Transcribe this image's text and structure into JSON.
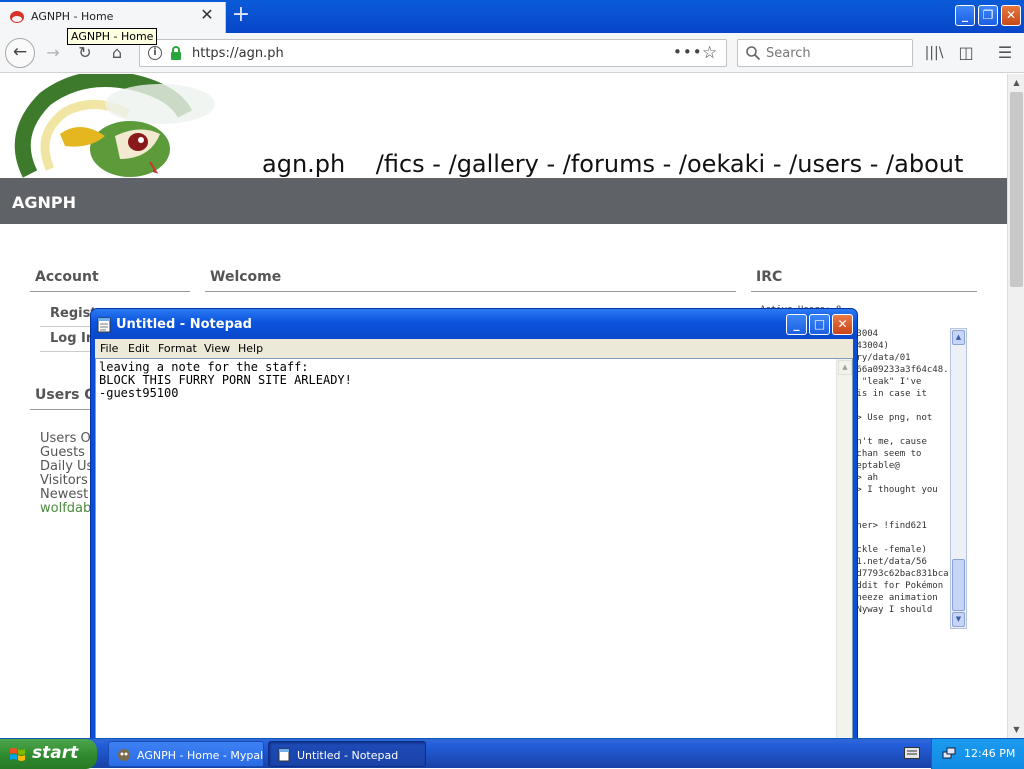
{
  "browser": {
    "tab_title": "AGNPH - Home",
    "tooltip": "AGNPH - Home",
    "url": "https://agn.ph",
    "search_placeholder": "Search"
  },
  "site": {
    "nav": [
      "agn.ph",
      "/fics",
      "-",
      "/gallery",
      "-",
      "/forums",
      "-",
      "/oekaki",
      "-",
      "/users",
      "-",
      "/about"
    ],
    "banner": "AGNPH",
    "account_heading": "Account",
    "welcome_heading": "Welcome",
    "irc_heading": "IRC",
    "account_links": [
      "Regist",
      "Log In"
    ],
    "users_heading": "Users O",
    "stats": [
      "Users O",
      "Guests",
      "Daily Us",
      "Visitors",
      "Newest",
      "wolfdab"
    ],
    "irc_lines": [
      "Active Users: 8",
      "43004",
      "343004)",
      "ery/data/01",
      "f66a09233a3f64c48.",
      "t \"leak\" I've",
      "his in case it",
      "",
      "e> Use png, not",
      "",
      "in't me, cause",
      "8chan seem to",
      "ceptable@",
      "e> ah",
      "e> I thought you",
      "",
      "",
      "iner> !find621",
      "",
      "uckle -female)",
      "21.net/data/56",
      "2d7793c62bac831bca.",
      "eddit for Pokémon",
      " sneeze animation",
      " ANyway I should"
    ]
  },
  "notepad": {
    "title": "Untitled - Notepad",
    "menu": [
      "File",
      "Edit",
      "Format",
      "View",
      "Help"
    ],
    "content": "leaving a note for the staff:\nBLOCK THIS FURRY PORN SITE ARLEADY!\n-guest95100"
  },
  "taskbar": {
    "start": "start",
    "items": [
      "AGNPH - Home - Mypal",
      "Untitled - Notepad"
    ],
    "clock": "12:46 PM"
  },
  "colors": {
    "banner": "#5f6368",
    "xp_blue": "#0a4fd6",
    "taskbar": "#245edb",
    "start_green": "#2f8a2d"
  }
}
